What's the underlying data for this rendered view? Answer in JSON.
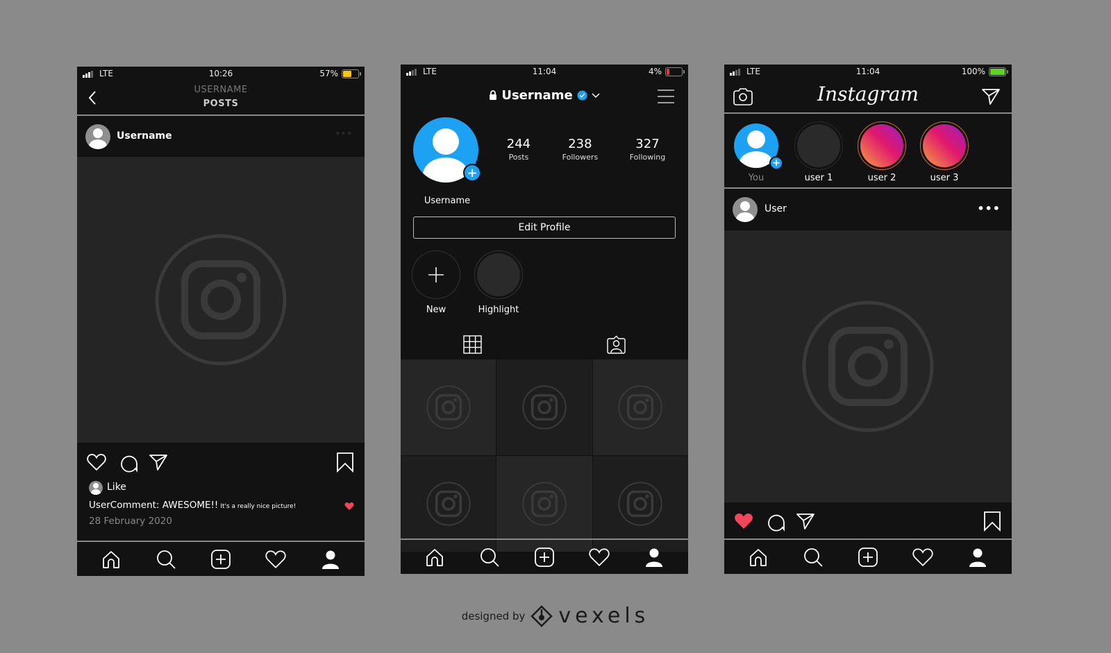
{
  "colors": {
    "background": "#8a8a8a",
    "screen": "#121212",
    "placeholder": "#252525",
    "accent_blue": "#1da1f2",
    "like_red": "#f0475a",
    "battery_yellow": "#f5c518",
    "battery_red": "#e53935",
    "battery_green": "#5fd31f"
  },
  "post_screen": {
    "status": {
      "network": "LTE",
      "time": "10:26",
      "battery_pct": "57%",
      "battery_level": 0.57
    },
    "header": {
      "subtitle": "USERNAME",
      "title": "POSTS"
    },
    "post": {
      "username": "Username"
    },
    "like_label": "Like",
    "comment": {
      "main": "UserComment: AWESOME!!",
      "small": "It's a really nice picture!"
    },
    "date": "28 February 2020"
  },
  "profile_screen": {
    "status": {
      "network": "LTE",
      "time": "11:04",
      "battery_pct": "4%",
      "battery_level": 0.04
    },
    "username_title": "Username",
    "stats": [
      {
        "value": "244",
        "label": "Posts"
      },
      {
        "value": "238",
        "label": "Followers"
      },
      {
        "value": "327",
        "label": "Following"
      }
    ],
    "display_name": "Username",
    "edit_profile_label": "Edit Profile",
    "highlights": [
      {
        "label": "New"
      },
      {
        "label": "Highlight"
      }
    ]
  },
  "feed_screen": {
    "status": {
      "network": "LTE",
      "time": "11:04",
      "battery_pct": "100%",
      "battery_level": 1.0
    },
    "logo": "Instagram",
    "stories": [
      {
        "label": "You"
      },
      {
        "label": "user 1"
      },
      {
        "label": "user 2"
      },
      {
        "label": "user 3"
      }
    ],
    "post": {
      "username": "User",
      "more": "•••"
    }
  },
  "credit": {
    "prefix": "designed by",
    "brand": "vexels"
  }
}
